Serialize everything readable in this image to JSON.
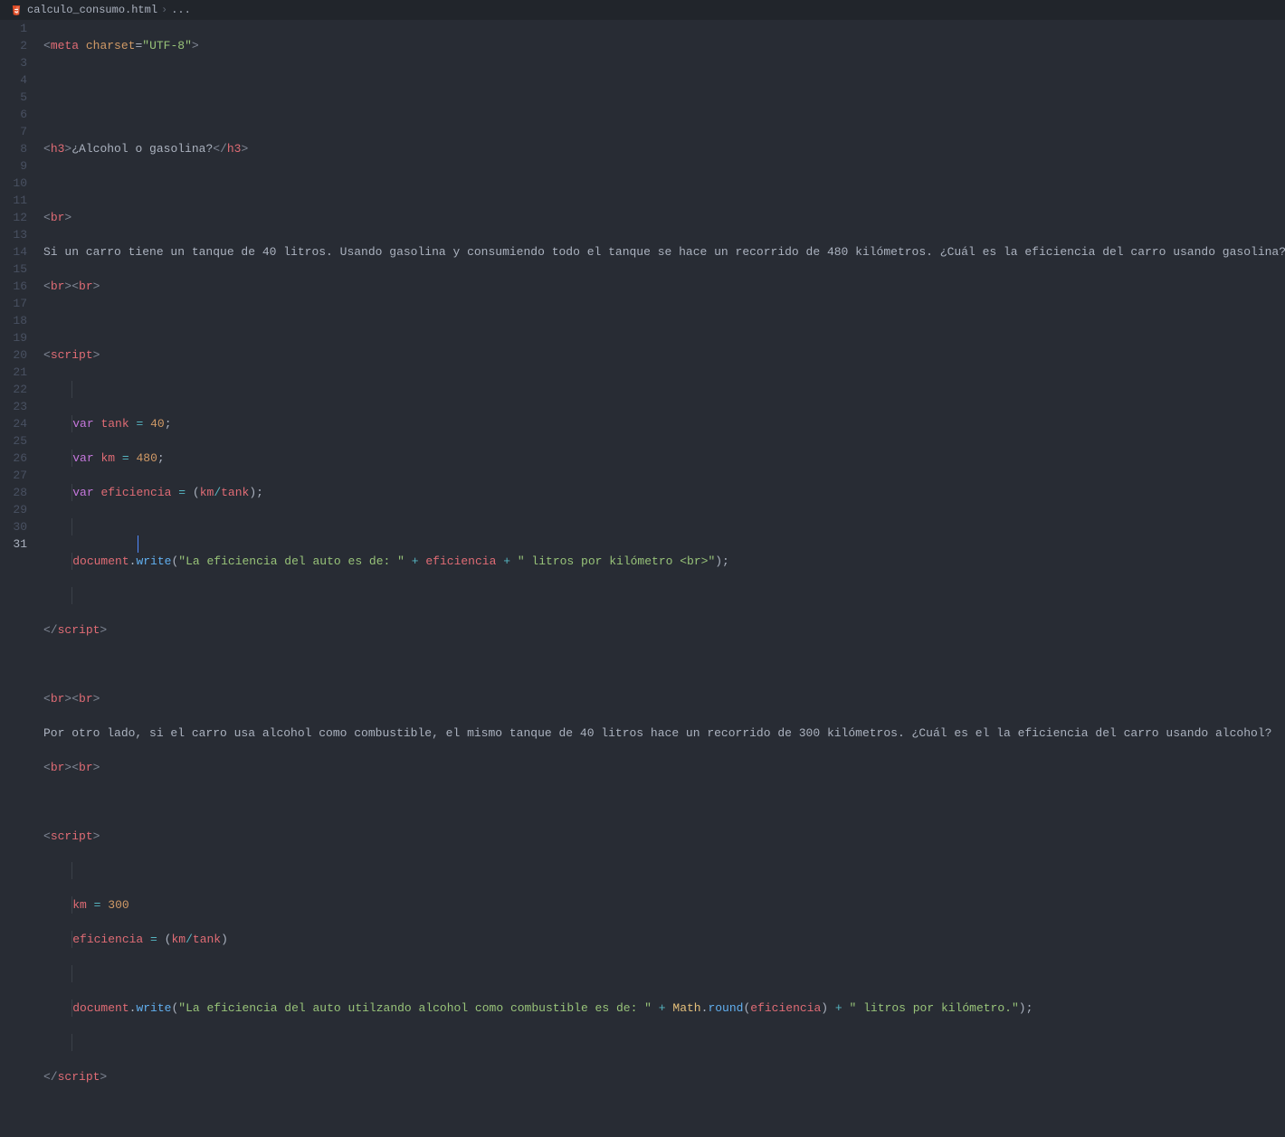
{
  "breadcrumb": {
    "filename": "calculo_consumo.html",
    "separator": "›",
    "trail": "..."
  },
  "gutter": {
    "total_lines": 31,
    "active_line": 31
  },
  "code": {
    "l1": {
      "tag": "meta",
      "attr": "charset",
      "val": "\"UTF-8\""
    },
    "l4": {
      "open": "h3",
      "text": "¿Alcohol o gasolina?",
      "close": "h3"
    },
    "l6": {
      "tag": "br"
    },
    "l7": "Si un carro tiene un tanque de 40 litros. Usando gasolina y consumiendo todo el tanque se hace un recorrido de 480 kilómetros. ¿Cuál es la eficiencia del carro usando gasolina?",
    "l8_a": {
      "tag": "br"
    },
    "l8_b": {
      "tag": "br"
    },
    "l10": {
      "tag": "script"
    },
    "l12": {
      "kw": "var",
      "name": "tank",
      "val": "40"
    },
    "l13": {
      "kw": "var",
      "name": "km",
      "val": "480"
    },
    "l14": {
      "kw": "var",
      "name": "eficiencia",
      "expr_a": "km",
      "expr_b": "tank"
    },
    "l16": {
      "obj": "document",
      "fn": "write",
      "s1": "\"La eficiencia del auto es de: \"",
      "v": "eficiencia",
      "s2": "\" litros por kilómetro <br>\""
    },
    "l18": {
      "close": "script"
    },
    "l20_a": {
      "tag": "br"
    },
    "l20_b": {
      "tag": "br"
    },
    "l21": "Por otro lado, si el carro usa alcohol como combustible, el mismo tanque de 40 litros hace un recorrido de 300 kilómetros. ¿Cuál es el la eficiencia del carro usando alcohol?",
    "l22_a": {
      "tag": "br"
    },
    "l22_b": {
      "tag": "br"
    },
    "l24": {
      "tag": "script"
    },
    "l26": {
      "name": "km",
      "val": "300"
    },
    "l27": {
      "name": "eficiencia",
      "expr_a": "km",
      "expr_b": "tank"
    },
    "l29": {
      "obj": "document",
      "fn": "write",
      "s1": "\"La eficiencia del auto utilzando alcohol como combustible es de: \"",
      "cls": "Math",
      "rfn": "round",
      "v": "eficiencia",
      "s2": "\" litros por kilómetro.\""
    },
    "l31": {
      "close": "script"
    }
  }
}
